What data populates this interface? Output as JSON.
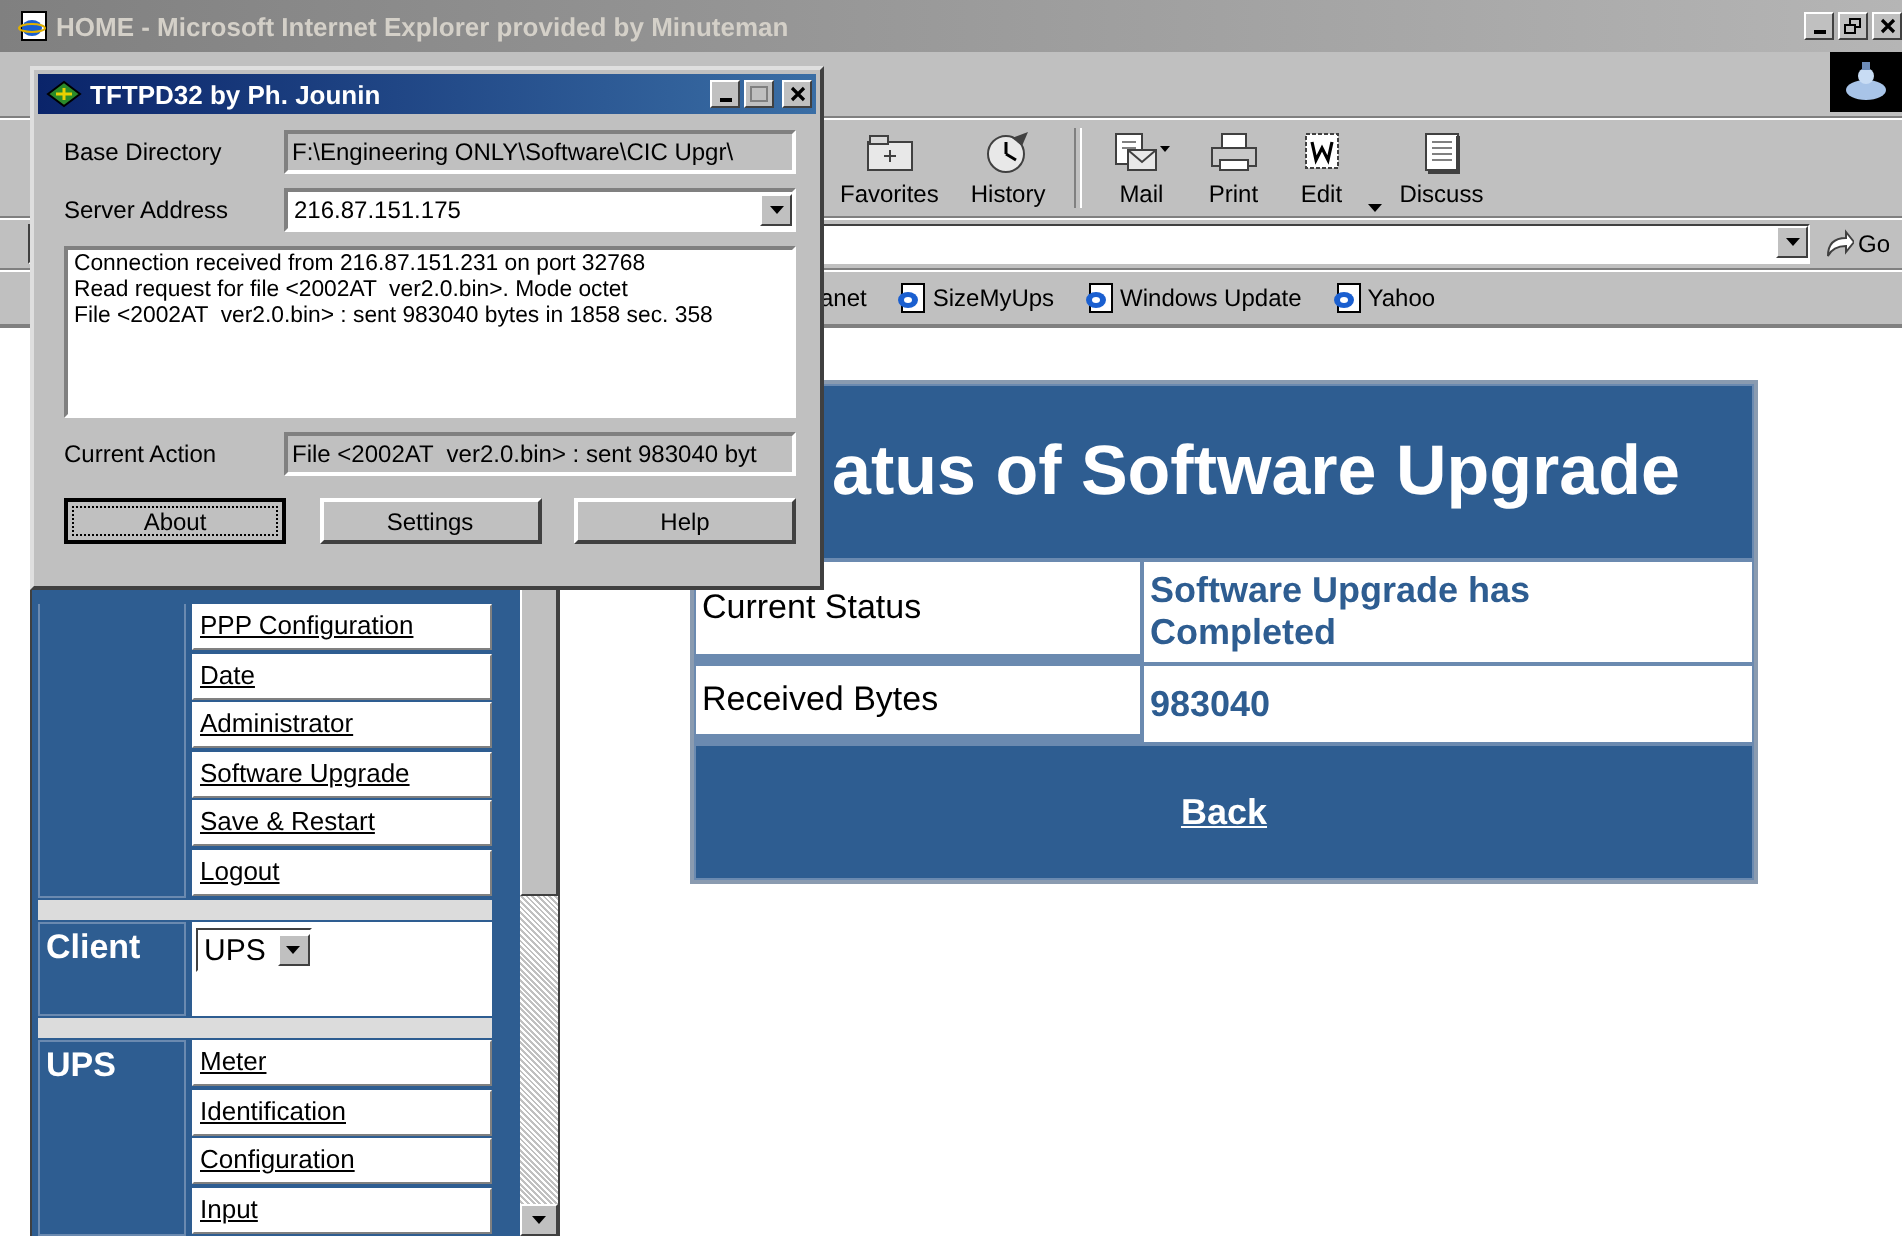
{
  "browser": {
    "title": "HOME - Microsoft Internet Explorer provided by Minuteman",
    "toolbar": [
      {
        "label": "Favorites",
        "kind": "folder"
      },
      {
        "label": "History",
        "kind": "clock"
      },
      {
        "label": "Mail",
        "kind": "mail"
      },
      {
        "label": "Print",
        "kind": "printer"
      },
      {
        "label": "Edit",
        "kind": "edit"
      },
      {
        "label": "Discuss",
        "kind": "discuss"
      }
    ],
    "go": "Go",
    "links": [
      {
        "label": "anet",
        "kind": "partial"
      },
      {
        "label": "SizeMyUps",
        "kind": "page"
      },
      {
        "label": "Windows Update",
        "kind": "page"
      },
      {
        "label": "Yahoo",
        "kind": "page"
      }
    ]
  },
  "nav": {
    "links": [
      "PPP Configuration",
      "Date",
      "Administrator",
      "Software Upgrade",
      "Save & Restart",
      "Logout"
    ],
    "client": {
      "label": "Client",
      "value": "UPS"
    },
    "ups": {
      "label": "UPS",
      "links": [
        "Meter",
        "Identification",
        "Configuration",
        "Input"
      ]
    }
  },
  "content": {
    "title": "atus of Software Upgrade",
    "rows": [
      {
        "label": "Current Status",
        "value": "Software Upgrade has Completed"
      },
      {
        "label": "Received Bytes",
        "value": "983040"
      }
    ],
    "back": "Back"
  },
  "dialog": {
    "title": "TFTPD32 by Ph. Jounin",
    "fields": [
      {
        "label": "Base Directory",
        "value": "F:\\Engineering ONLY\\Software\\CIC Upgr\\",
        "kind": "readonly"
      },
      {
        "label": "Server Address",
        "value": "216.87.151.175",
        "kind": "combo"
      }
    ],
    "log": [
      "Connection received from 216.87.151.231 on port 32768",
      "Read request for file <2002AT  ver2.0.bin>. Mode octet",
      "File <2002AT  ver2.0.bin> : sent 983040 bytes in 1858 sec. 358"
    ],
    "current_action": {
      "label": "Current Action",
      "value": "File <2002AT  ver2.0.bin> : sent 983040 byt"
    },
    "buttons": [
      {
        "label": "About",
        "default": true
      },
      {
        "label": "Settings",
        "default": false
      },
      {
        "label": "Help",
        "default": false
      }
    ]
  }
}
